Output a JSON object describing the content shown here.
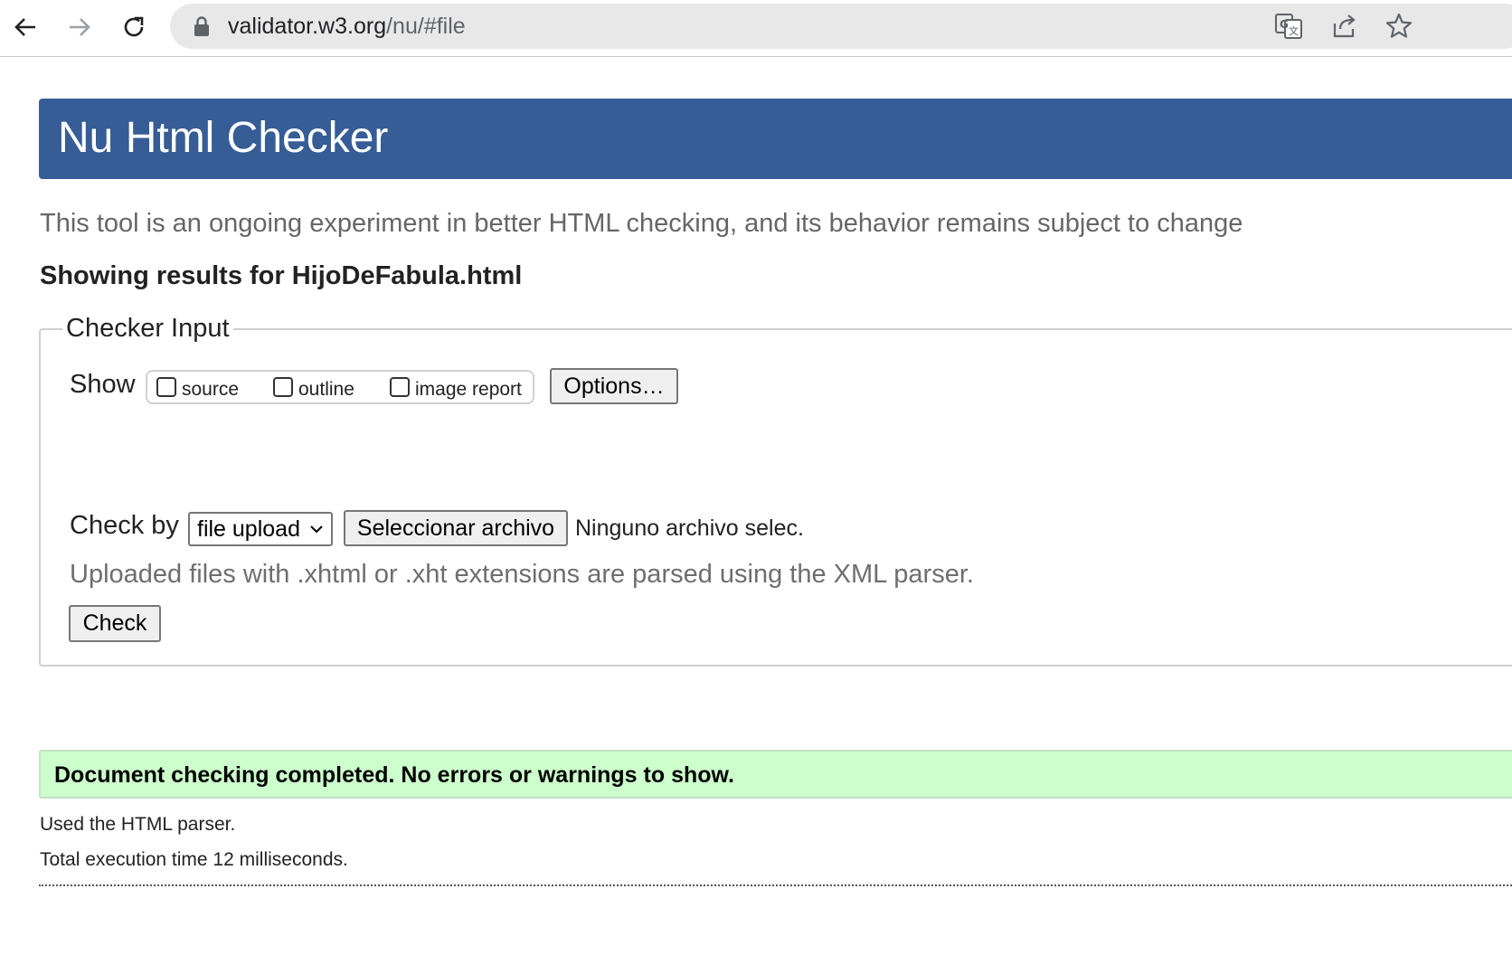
{
  "browser": {
    "url_host": "validator.w3.org",
    "url_path": "/nu/#file",
    "icons": [
      "back-arrow-icon",
      "forward-arrow-icon",
      "reload-icon",
      "lock-icon",
      "translate-icon",
      "share-icon",
      "bookmark-star-icon"
    ]
  },
  "page": {
    "header_title": "Nu Html Checker",
    "subtitle": "This tool is an ongoing experiment in better HTML checking, and its behavior remains subject to change",
    "results_heading": "Showing results for HijoDeFabula.html"
  },
  "checker": {
    "legend": "Checker Input",
    "show_label": "Show",
    "show_options": [
      {
        "label": "source",
        "checked": false
      },
      {
        "label": "outline",
        "checked": false
      },
      {
        "label": "image report",
        "checked": false
      }
    ],
    "options_button": "Options…",
    "check_by_label": "Check by",
    "check_by_value": "file upload",
    "file_button": "Seleccionar archivo",
    "file_status": "Ninguno archivo selec.",
    "hint": "Uploaded files with .xhtml or .xht extensions are parsed using the XML parser.",
    "check_button": "Check"
  },
  "results": {
    "success_message": "Document checking completed. No errors or warnings to show.",
    "parser_info": "Used the HTML parser.",
    "execution_time": "Total execution time 12 milliseconds."
  },
  "colors": {
    "header_bg": "#365d95",
    "success_bg": "#ccffcc"
  }
}
